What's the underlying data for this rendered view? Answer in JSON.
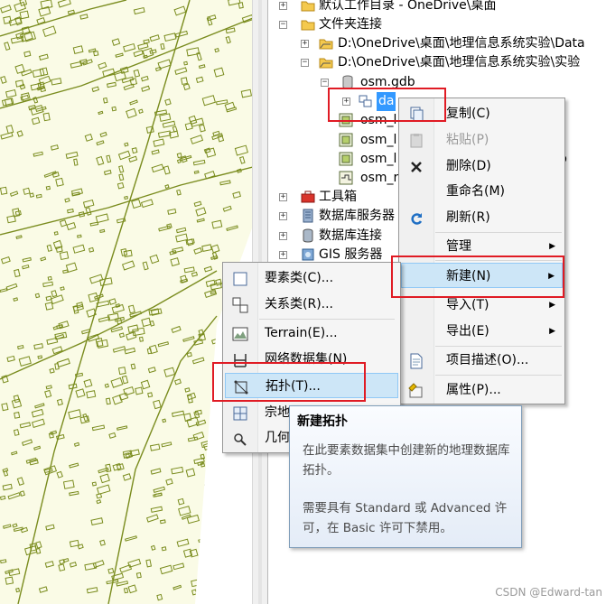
{
  "tree": {
    "items": [
      {
        "label": "默认工作目录 - OneDrive\\桌面",
        "expander": "+",
        "icon": "folder-home-icon"
      },
      {
        "label": "文件夹连接",
        "expander": "−",
        "icon": "folder-connections-icon"
      },
      {
        "label": "D:\\OneDrive\\桌面\\地理信息系统实验\\Data",
        "expander": "+",
        "icon": "folder-connection-icon"
      },
      {
        "label": "D:\\OneDrive\\桌面\\地理信息系统实验\\实验",
        "expander": "−",
        "icon": "folder-connection-icon"
      },
      {
        "label": "osm.gdb",
        "expander": "−",
        "icon": "geodatabase-icon"
      },
      {
        "label": "da",
        "expander": "+",
        "icon": "feature-dataset-icon"
      },
      {
        "label": "osm_l",
        "icon": "polygon-featureclass-icon"
      },
      {
        "label": "osm_l",
        "icon": "polygon-featureclass-icon"
      },
      {
        "label": "osm_l",
        "icon": "polygon-featureclass-icon"
      },
      {
        "label": "osm_r",
        "icon": "line-featureclass-icon"
      },
      {
        "label": "工具箱",
        "expander": "+",
        "icon": "toolbox-icon"
      },
      {
        "label": "数据库服务器",
        "expander": "+",
        "icon": "database-server-icon"
      },
      {
        "label": "数据库连接",
        "expander": "+",
        "icon": "database-connection-icon"
      },
      {
        "label": "GIS 服务器",
        "expander": "+",
        "icon": "gis-server-icon"
      }
    ],
    "tail_suffix": "p"
  },
  "context_menu": {
    "copy": "复制(C)",
    "paste": "粘贴(P)",
    "delete": "删除(D)",
    "rename": "重命名(M)",
    "refresh": "刷新(R)",
    "manage": "管理",
    "new": "新建(N)",
    "import": "导入(T)",
    "export": "导出(E)",
    "item_description": "项目描述(O)...",
    "properties": "属性(P)..."
  },
  "submenu": {
    "feature_class": "要素类(C)...",
    "relationship_class": "关系类(R)...",
    "terrain": "Terrain(E)...",
    "network_dataset": "网络数据集(N)",
    "topology": "拓扑(T)...",
    "parcel_fabric": "宗地",
    "geometric_network": "几何"
  },
  "tooltip": {
    "title": "新建拓扑",
    "body": "在此要素数据集中创建新的地理数据库拓扑。",
    "note": "需要具有 Standard 或 Advanced 许可，在 Basic 许可下禁用。"
  },
  "watermark": "CSDN @Edward-tan",
  "colors": {
    "map_bg": "#fafbe6",
    "map_line": "#7a8c1e",
    "highlight": "#cde6f7",
    "red_box": "#e01b24"
  }
}
